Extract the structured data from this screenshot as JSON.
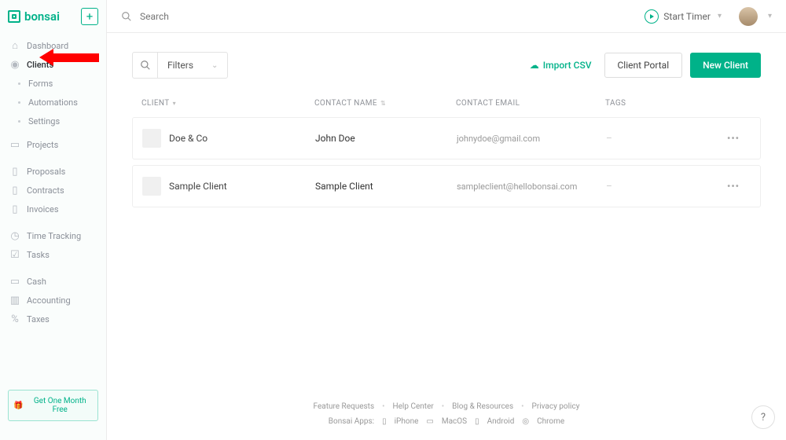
{
  "brand": {
    "name": "bonsai"
  },
  "sidebar": {
    "add_label": "+",
    "items": [
      {
        "label": "Dashboard",
        "icon": "home"
      },
      {
        "label": "Clients",
        "icon": "globe",
        "active": true
      },
      {
        "label": "Forms",
        "sub": true
      },
      {
        "label": "Automations",
        "sub": true
      },
      {
        "label": "Settings",
        "sub": true
      },
      {
        "label": "Projects",
        "icon": "folder"
      },
      {
        "label": "Proposals",
        "icon": "doc"
      },
      {
        "label": "Contracts",
        "icon": "doc"
      },
      {
        "label": "Invoices",
        "icon": "doc"
      },
      {
        "label": "Time Tracking",
        "icon": "clock"
      },
      {
        "label": "Tasks",
        "icon": "check"
      },
      {
        "label": "Cash",
        "icon": "card"
      },
      {
        "label": "Accounting",
        "icon": "ledger"
      },
      {
        "label": "Taxes",
        "icon": "percent"
      }
    ],
    "promo": "Get One Month Free"
  },
  "topbar": {
    "search_placeholder": "Search",
    "timer_label": "Start Timer"
  },
  "toolbar": {
    "filters_label": "Filters",
    "import_label": "Import CSV",
    "portal_label": "Client Portal",
    "new_label": "New Client"
  },
  "columns": {
    "client": "CLIENT",
    "contact": "CONTACT NAME",
    "email": "CONTACT EMAIL",
    "tags": "TAGS"
  },
  "rows": [
    {
      "client": "Doe & Co",
      "contact": "John Doe",
      "email": "johnydoe@gmail.com",
      "tags": "–"
    },
    {
      "client": "Sample Client",
      "contact": "Sample Client",
      "email": "sampleclient@hellobonsai.com",
      "tags": "–"
    }
  ],
  "footer": {
    "links": [
      "Feature Requests",
      "Help Center",
      "Blog & Resources",
      "Privacy policy"
    ],
    "apps_label": "Bonsai Apps:",
    "apps": [
      "iPhone",
      "MacOS",
      "Android",
      "Chrome"
    ]
  },
  "help_fab": "?"
}
